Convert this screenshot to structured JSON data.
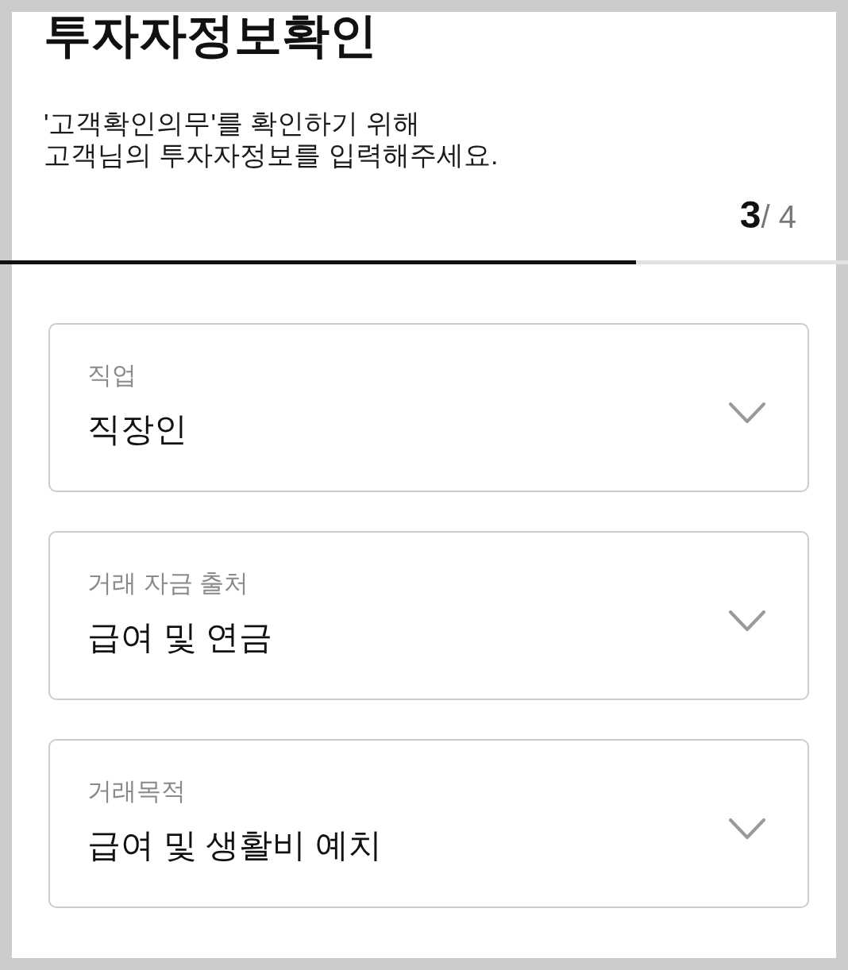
{
  "header": {
    "title": "투자자정보확인",
    "description_lines": [
      "'고객확인의무'를 확인하기 위해",
      "고객님의 투자자정보를 입력해주세요."
    ],
    "step": {
      "current": "3",
      "of_total": "/ 4"
    }
  },
  "progress": {
    "level": 0.75
  },
  "fields": [
    {
      "label": "직업",
      "value": "직장인"
    },
    {
      "label": "거래 자금 출처",
      "value": "급여 및 연금"
    },
    {
      "label": "거래목적",
      "value": "급여 및 생활비 예치"
    }
  ]
}
